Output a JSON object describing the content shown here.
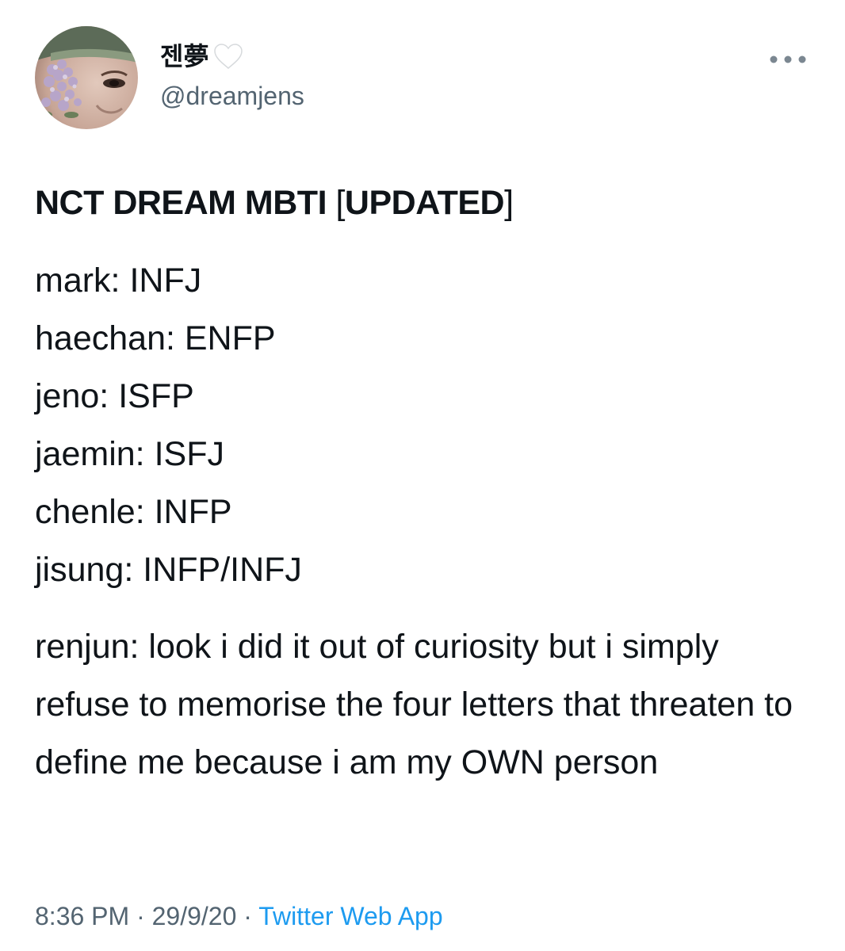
{
  "user": {
    "display_name": "젠夢",
    "handle": "@dreamjens",
    "avatar_icon": "profile-photo-with-flowers",
    "name_emoji_icon": "white-heart-icon"
  },
  "menu": {
    "icon": "more-horizontal-icon"
  },
  "tweet": {
    "title_main": "NCT DREAM MBTI ",
    "title_bracket_open": "[",
    "title_word": "UPDATED",
    "title_bracket_close": "]",
    "mbti_lines": [
      "mark: INFJ",
      "haechan: ENFP",
      "jeno: ISFP",
      "jaemin: ISFJ",
      "chenle: INFP",
      "jisung: INFP/INFJ"
    ],
    "renjun_paragraph": "renjun: look i did it out of curiosity but i simply refuse to memorise the four letters that threaten to define me because i am my OWN person"
  },
  "meta": {
    "time": "8:36 PM",
    "separator": " · ",
    "date": "29/9/20",
    "source": "Twitter Web App"
  },
  "colors": {
    "text": "#0f1419",
    "secondary": "#536471",
    "link": "#1d9bf0"
  }
}
